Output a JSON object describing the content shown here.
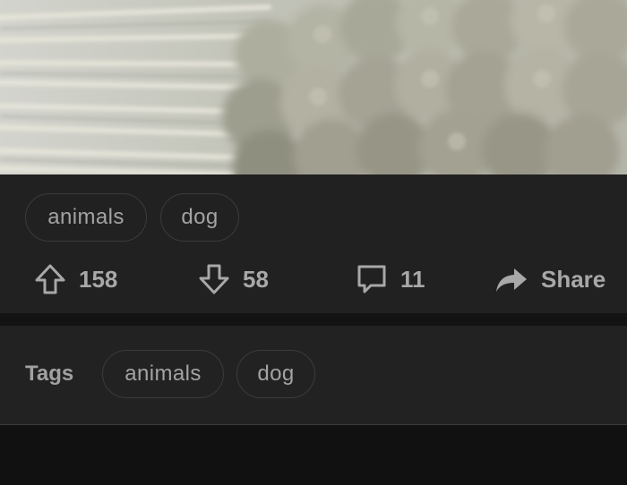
{
  "post": {
    "tags": [
      "animals",
      "dog"
    ],
    "upvotes": "158",
    "downvotes": "58",
    "comments": "11",
    "share_label": "Share"
  },
  "tags_section": {
    "label": "Tags",
    "tags": [
      "animals",
      "dog"
    ]
  },
  "icons": {
    "upvote": "arrow-up-icon",
    "downvote": "arrow-down-icon",
    "comment": "comment-bubble-icon",
    "share": "share-arrow-icon"
  },
  "colors": {
    "card_bg": "#212121",
    "page_bg": "#111112",
    "text": "#a8a8a8",
    "pill_border": "#3b3b3b"
  }
}
